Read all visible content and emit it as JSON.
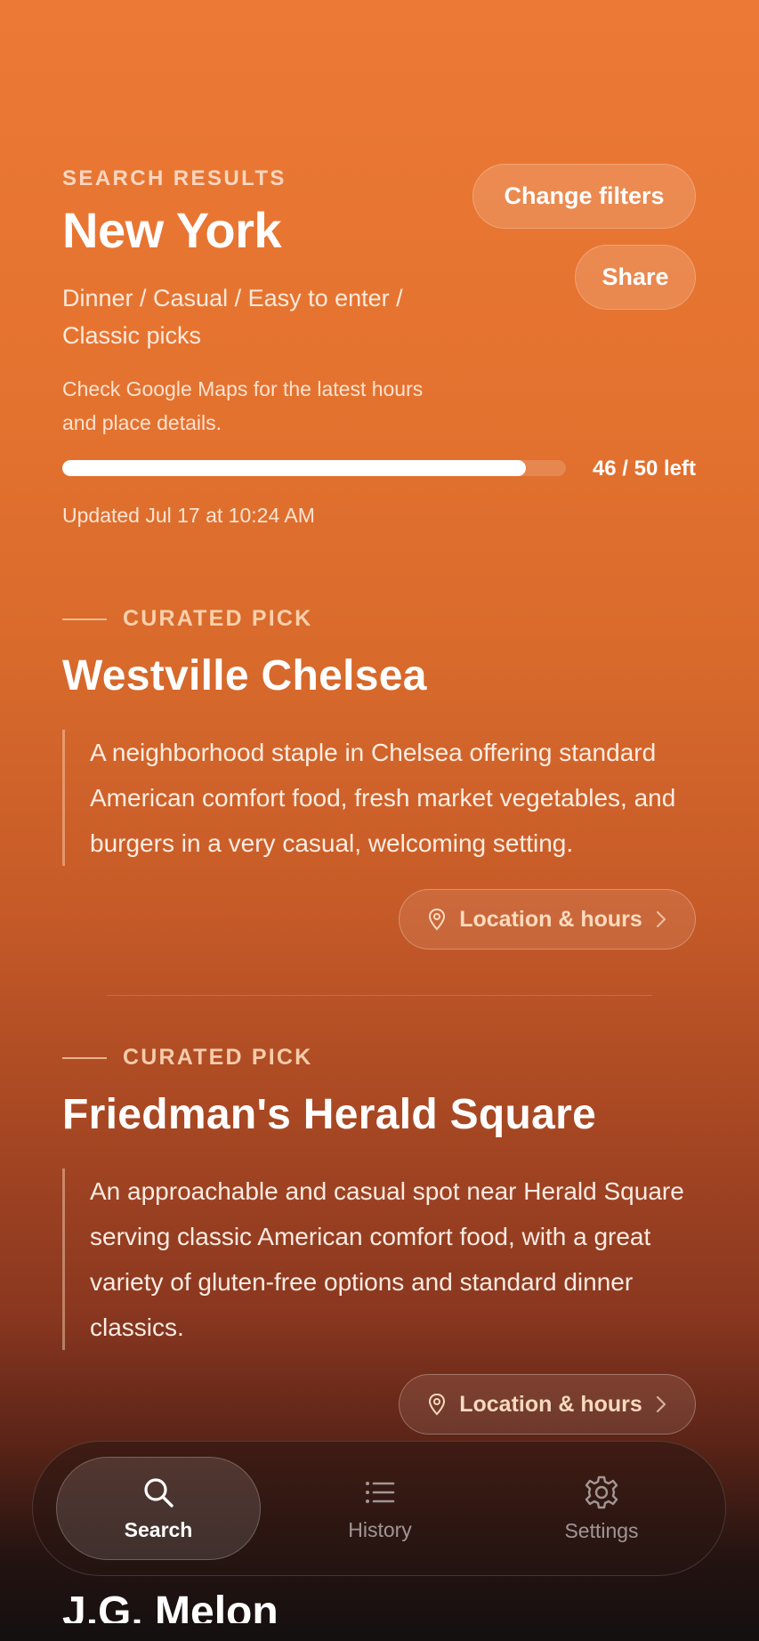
{
  "header": {
    "eyebrow": "SEARCH RESULTS",
    "city": "New York",
    "filters": "Dinner / Casual / Easy to enter / Classic picks",
    "notice": "Check Google Maps for the latest hours and place details.",
    "change_filters_label": "Change filters",
    "share_label": "Share"
  },
  "quota": {
    "remaining": 46,
    "total": 50,
    "label": "46 / 50 left",
    "fill_fraction": 0.92
  },
  "updated": "Updated Jul 17 at 10:24 AM",
  "picks": [
    {
      "eyebrow": "CURATED PICK",
      "name": "Westville Chelsea",
      "description": "A neighborhood staple in Chelsea offering standard American comfort food, fresh market vegetables, and burgers in a very casual, welcoming setting.",
      "location_label": "Location & hours"
    },
    {
      "eyebrow": "CURATED PICK",
      "name": "Friedman's Herald Square",
      "description": "An approachable and casual spot near Herald Square serving classic American comfort food, with a great variety of gluten-free options and standard dinner classics.",
      "location_label": "Location & hours"
    },
    {
      "name": "J.G. Melon"
    }
  ],
  "tabs": [
    {
      "label": "Search",
      "icon": "search-icon",
      "active": true
    },
    {
      "label": "History",
      "icon": "list-icon",
      "active": false
    },
    {
      "label": "Settings",
      "icon": "gear-icon",
      "active": false
    }
  ],
  "colors": {
    "background_top": "#ec7a36",
    "background_bottom": "#141010",
    "accent_text": "#ffdebe"
  }
}
